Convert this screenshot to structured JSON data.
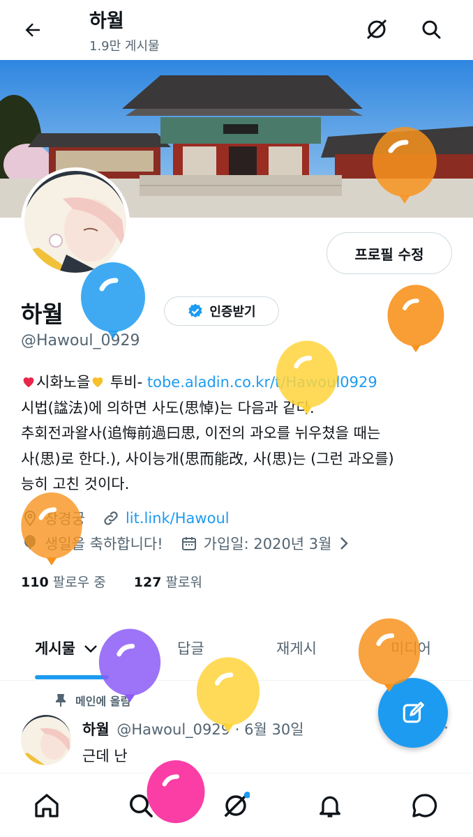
{
  "header": {
    "title": "하월",
    "subtitle": "1.9만 게시물"
  },
  "profile": {
    "edit_button": "프로필 수정",
    "display_name": "하월",
    "verify_button": "인증받기",
    "handle": "@Hawoul_0929",
    "bio": {
      "line1_a": "시화노을",
      "line1_b": " 투비- ",
      "line1_link": "tobe.aladin.co.kr/t/Hawoul0929",
      "line2": "시법(諡法)에 의하면 사도(思悼)는 다음과 같다.",
      "line3": "추회전과왈사(追悔前過曰思, 이전의 과오를 뉘우쳤을 때는",
      "line4": "사(思)로 한다.), 사이능개(思而能改, 사(思)는 (그런 과오를)",
      "line5": "능히 고친 것이다."
    },
    "location": "창경궁",
    "website": "lit.link/Hawoul",
    "birthday_text": "생일을 축하합니다!",
    "joined": "가입일: 2020년 3월",
    "following_count": "110",
    "following_label": "팔로우 중",
    "followers_count": "127",
    "followers_label": "팔로워"
  },
  "tabs": [
    {
      "label": "게시물"
    },
    {
      "label": "답글"
    },
    {
      "label": "재게시"
    },
    {
      "label": "미디어"
    }
  ],
  "pinned_post": {
    "pinned_label": "메인에 올림",
    "author": "하월",
    "meta": "@Hawoul_0929 · 6월 30일",
    "text": "근데 난",
    "more": "·"
  },
  "colors": {
    "accent": "#1d9bf0",
    "text": "#0f1419",
    "secondary": "#536471",
    "balloon_orange": "#f7931e",
    "balloon_blue": "#1d9bf0",
    "balloon_yellow": "#ffd43b",
    "balloon_purple": "#8c5cf6",
    "balloon_pink": "#f9239a"
  },
  "icons": {
    "back": "arrow-left-icon",
    "grok": "grok-icon",
    "search": "search-icon",
    "location": "location-pin-icon",
    "link": "link-icon",
    "birthday": "balloon-icon",
    "calendar": "calendar-icon",
    "compose": "compose-icon",
    "home": "home-icon",
    "notifications": "bell-icon",
    "messages": "message-icon"
  }
}
